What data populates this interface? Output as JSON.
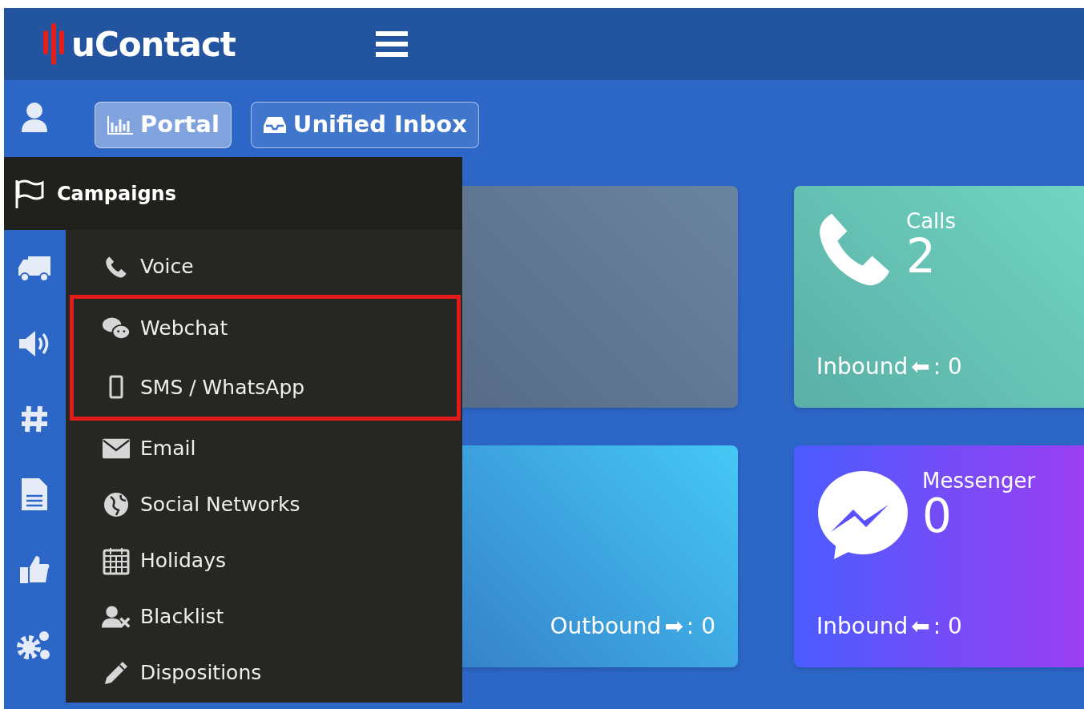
{
  "header": {
    "brand": "uContact"
  },
  "tabs": [
    {
      "label": "Portal",
      "selected": true
    },
    {
      "label": "Unified Inbox",
      "selected": false
    }
  ],
  "menu": {
    "title": "Campaigns",
    "items": [
      {
        "label": "Voice",
        "highlighted": false
      },
      {
        "label": "Webchat",
        "highlighted": true
      },
      {
        "label": "SMS / WhatsApp",
        "highlighted": true
      },
      {
        "label": "Email",
        "highlighted": false
      },
      {
        "label": "Social Networks",
        "highlighted": false
      },
      {
        "label": "Holidays",
        "highlighted": false
      },
      {
        "label": "Blacklist",
        "highlighted": false
      },
      {
        "label": "Dispositions",
        "highlighted": false
      }
    ]
  },
  "cards": [
    {
      "kind": "covered"
    },
    {
      "kind": "calls",
      "title": "Calls",
      "value": "2",
      "footer_label": "Inbound",
      "arrow": "⬅",
      "footer_value": ": 0"
    },
    {
      "kind": "plain",
      "footer_label": "Outbound",
      "arrow": "➡",
      "footer_value": ": 0"
    },
    {
      "kind": "messenger",
      "title": "Messenger",
      "value": "0",
      "footer_label": "Inbound",
      "arrow": "⬅",
      "footer_value": ": 0"
    }
  ]
}
